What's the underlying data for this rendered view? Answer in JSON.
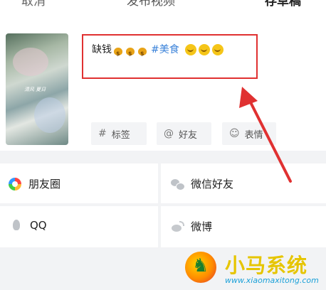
{
  "header": {
    "cancel_label": "取消",
    "title": "发布视频",
    "save_draft_label": "存草稿"
  },
  "video": {
    "thumbnail_caption": "清风 夏日"
  },
  "description": {
    "text": "缺钱",
    "hashtag": "#美食",
    "money_bag_emoji_count": 3,
    "smiley_emoji_count": 3
  },
  "tag_buttons": [
    {
      "icon": "hashtag-icon",
      "label": "标签"
    },
    {
      "icon": "at-icon",
      "label": "好友"
    },
    {
      "icon": "smiley-icon",
      "label": "表情"
    }
  ],
  "share_targets": [
    {
      "icon": "moments-icon",
      "label": "朋友圈"
    },
    {
      "icon": "wechat-icon",
      "label": "微信好友"
    },
    {
      "icon": "qq-icon",
      "label": "QQ"
    },
    {
      "icon": "weibo-icon",
      "label": "微博"
    }
  ],
  "watermark": {
    "title": "小马系统",
    "url": "www.xiaomaxitong.com"
  },
  "colors": {
    "highlight_box": "#e03131",
    "arrow": "#e03131",
    "hashtag": "#3a82d9",
    "section_gray": "#f2f3f5"
  }
}
